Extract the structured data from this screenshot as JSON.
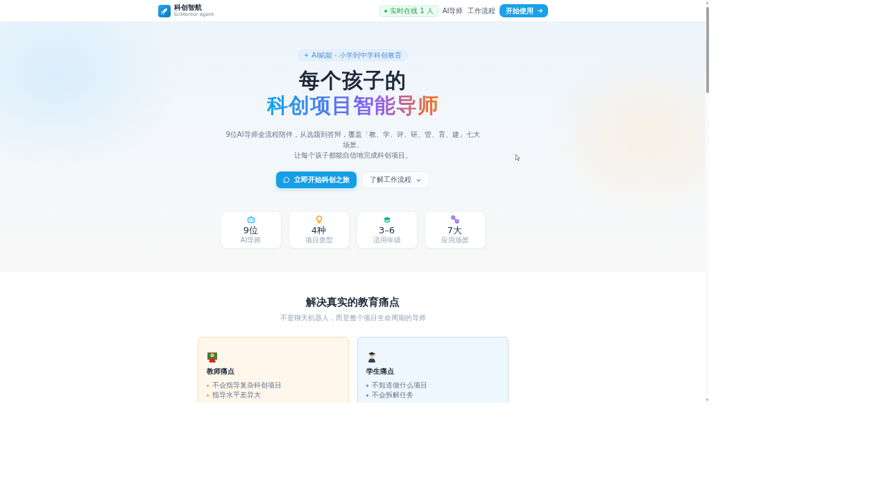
{
  "header": {
    "brand_name": "科创智航",
    "brand_tagline": "SciMentor Agent",
    "online_badge": "实时在线 1 人",
    "nav_links": [
      "AI导师",
      "工作流程"
    ],
    "cta_button": "开始使用"
  },
  "hero": {
    "pill": "AI赋能 · 小学到中学科创教育",
    "title_line_1": "每个孩子的",
    "title_line_2": "科创项目智能导师",
    "description": [
      "9位AI导师全流程陪伴，从选题到答辩，覆盖「教、学、评、研、管、育、建」七大场景。",
      "让每个孩子都能自信地完成科创项目。"
    ],
    "buttons": [
      {
        "kind": "primary",
        "label": "立即开始科创之旅"
      },
      {
        "kind": "secondary",
        "label": "了解工作流程"
      }
    ],
    "stats": [
      {
        "kind": "robot",
        "color": "#38bdf8",
        "value": "9位",
        "label": "AI导师"
      },
      {
        "kind": "bulb",
        "color": "#f59e0b",
        "value": "4种",
        "label": "项目类型"
      },
      {
        "kind": "cap",
        "color": "#10b981",
        "value": "3–6",
        "label": "适用年级"
      },
      {
        "kind": "nodes",
        "color": "#8b5cf6",
        "value": "7大",
        "label": "应用场景"
      }
    ]
  },
  "pain_points": {
    "title": "解决真实的教育痛点",
    "subtitle": "不是聊天机器人，而是整个项目生命周期的导师",
    "cards": [
      {
        "kind": "teacher",
        "title": "教师痛点",
        "items": [
          "不会指导复杂科创项目",
          "指导水平差异大"
        ]
      },
      {
        "kind": "student",
        "title": "学生痛点",
        "items": [
          "不知道做什么项目",
          "不会拆解任务"
        ]
      }
    ]
  }
}
